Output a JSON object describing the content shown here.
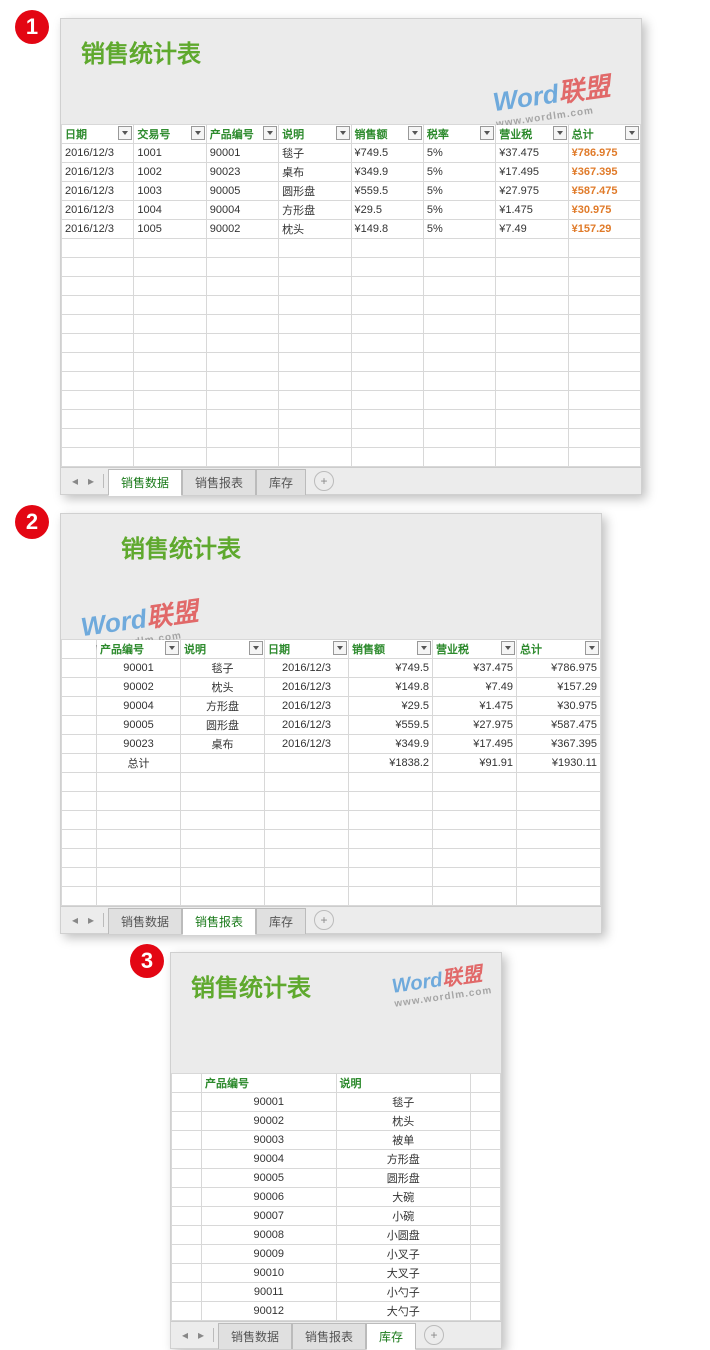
{
  "watermark": {
    "text": "Word",
    "text2": "联盟",
    "sub": "www.wordlm.com"
  },
  "tabs": {
    "t1": "销售数据",
    "t2": "销售报表",
    "t3": "库存"
  },
  "panel1": {
    "title": "销售统计表",
    "headers": [
      "日期",
      "交易号",
      "产品编号",
      "说明",
      "销售额",
      "税率",
      "营业税",
      "总计"
    ],
    "rows": [
      [
        "2016/12/3",
        "1001",
        "90001",
        "毯子",
        "¥749.5",
        "5%",
        "¥37.475",
        "¥786.975"
      ],
      [
        "2016/12/3",
        "1002",
        "90023",
        "桌布",
        "¥349.9",
        "5%",
        "¥17.495",
        "¥367.395"
      ],
      [
        "2016/12/3",
        "1003",
        "90005",
        "圆形盘",
        "¥559.5",
        "5%",
        "¥27.975",
        "¥587.475"
      ],
      [
        "2016/12/3",
        "1004",
        "90004",
        "方形盘",
        "¥29.5",
        "5%",
        "¥1.475",
        "¥30.975"
      ],
      [
        "2016/12/3",
        "1005",
        "90002",
        "枕头",
        "¥149.8",
        "5%",
        "¥7.49",
        "¥157.29"
      ]
    ]
  },
  "panel2": {
    "title": "销售统计表",
    "headers": [
      "产品编号",
      "说明",
      "日期",
      "销售额",
      "营业税",
      "总计"
    ],
    "rows": [
      [
        "90001",
        "毯子",
        "2016/12/3",
        "¥749.5",
        "¥37.475",
        "¥786.975"
      ],
      [
        "90002",
        "枕头",
        "2016/12/3",
        "¥149.8",
        "¥7.49",
        "¥157.29"
      ],
      [
        "90004",
        "方形盘",
        "2016/12/3",
        "¥29.5",
        "¥1.475",
        "¥30.975"
      ],
      [
        "90005",
        "圆形盘",
        "2016/12/3",
        "¥559.5",
        "¥27.975",
        "¥587.475"
      ],
      [
        "90023",
        "桌布",
        "2016/12/3",
        "¥349.9",
        "¥17.495",
        "¥367.395"
      ],
      [
        "总计",
        "",
        "",
        "¥1838.2",
        "¥91.91",
        "¥1930.11"
      ]
    ]
  },
  "panel3": {
    "title": "销售统计表",
    "headers": [
      "产品编号",
      "说明"
    ],
    "rows": [
      [
        "90001",
        "毯子"
      ],
      [
        "90002",
        "枕头"
      ],
      [
        "90003",
        "被单"
      ],
      [
        "90004",
        "方形盘"
      ],
      [
        "90005",
        "圆形盘"
      ],
      [
        "90006",
        "大碗"
      ],
      [
        "90007",
        "小碗"
      ],
      [
        "90008",
        "小圆盘"
      ],
      [
        "90009",
        "小叉子"
      ],
      [
        "90010",
        "大叉子"
      ],
      [
        "90011",
        "小勺子"
      ],
      [
        "90012",
        "大勺子"
      ]
    ]
  }
}
